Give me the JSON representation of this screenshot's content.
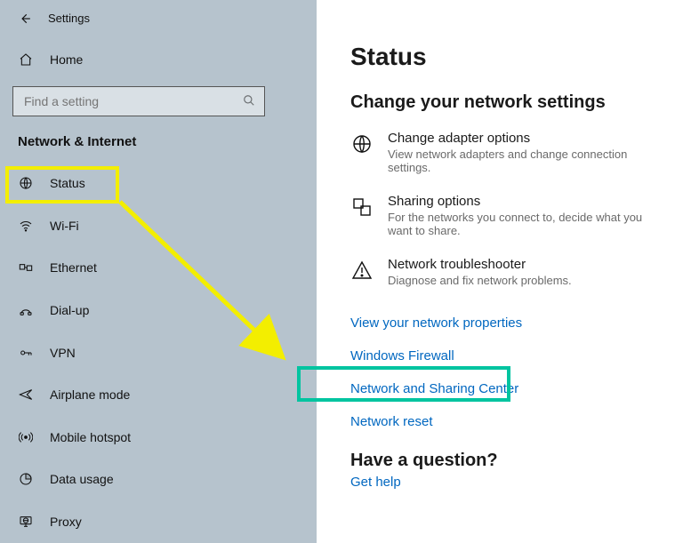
{
  "header": {
    "app_title": "Settings"
  },
  "sidebar": {
    "home_label": "Home",
    "search_placeholder": "Find a setting",
    "section_title": "Network & Internet",
    "items": [
      {
        "label": "Status"
      },
      {
        "label": "Wi-Fi"
      },
      {
        "label": "Ethernet"
      },
      {
        "label": "Dial-up"
      },
      {
        "label": "VPN"
      },
      {
        "label": "Airplane mode"
      },
      {
        "label": "Mobile hotspot"
      },
      {
        "label": "Data usage"
      },
      {
        "label": "Proxy"
      }
    ]
  },
  "content": {
    "page_title": "Status",
    "section_heading": "Change your network settings",
    "options": [
      {
        "title": "Change adapter options",
        "subtitle": "View network adapters and change connection settings."
      },
      {
        "title": "Sharing options",
        "subtitle": "For the networks you connect to, decide what you want to share."
      },
      {
        "title": "Network troubleshooter",
        "subtitle": "Diagnose and fix network problems."
      }
    ],
    "links": [
      "View your network properties",
      "Windows Firewall",
      "Network and Sharing Center",
      "Network reset"
    ],
    "question_heading": "Have a question?",
    "question_link": "Get help"
  },
  "colors": {
    "sidebar_bg": "#b6c3cd",
    "link": "#0067c0",
    "highlight_yellow": "#f3ee00",
    "highlight_teal": "#00c4a0"
  }
}
